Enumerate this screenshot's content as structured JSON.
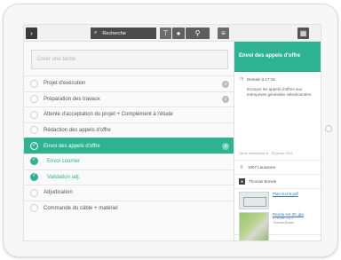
{
  "topbar": {
    "search_label": "Recherche",
    "icons": [
      "chevron-right-icon",
      "search-icon",
      "filter-icon",
      "pin-icon",
      "list-icon",
      "grid-icon"
    ]
  },
  "new_task_placeholder": "Créer une tâche",
  "tasks": [
    {
      "label": "Projet d'exécution",
      "badge": "3",
      "state": "open"
    },
    {
      "label": "Préparation des travaux",
      "badge": "3",
      "state": "open"
    },
    {
      "label": "Attente d'acceptation du projet + Complément à l'étude",
      "badge": "",
      "state": "open"
    },
    {
      "label": "Rédaction des appels d'offre",
      "badge": "",
      "state": "open"
    },
    {
      "label": "Envoi des appels d'offre",
      "badge": "3",
      "state": "active"
    },
    {
      "label": "Envoi courrier",
      "badge": "",
      "state": "done"
    },
    {
      "label": "Validation adj.",
      "badge": "",
      "state": "done"
    },
    {
      "label": "Adjudication",
      "badge": "",
      "state": "open"
    },
    {
      "label": "Commande du câble + matériel",
      "badge": "",
      "state": "open"
    }
  ],
  "detail": {
    "title": "Envoi des appels d'offre",
    "due": "Demain à 17:15",
    "description": "Envoyer les appels d'offres aux entreprises générales sélectionnées.",
    "created_label": "Tâche commencée le",
    "created_date": "25 janvier 2013",
    "location": "1007 Lausanne",
    "user": "Thomas Borwin",
    "files": [
      {
        "name": "Plan-Ext B.pdf",
        "meta1": "",
        "meta2": ""
      },
      {
        "name": "Rendu ext 3C.jpg",
        "meta1": "5 Février 2013",
        "meta2": "Thomas Borwin"
      }
    ]
  },
  "colors": {
    "accent": "#2db391",
    "dark": "#3a3a3a"
  }
}
